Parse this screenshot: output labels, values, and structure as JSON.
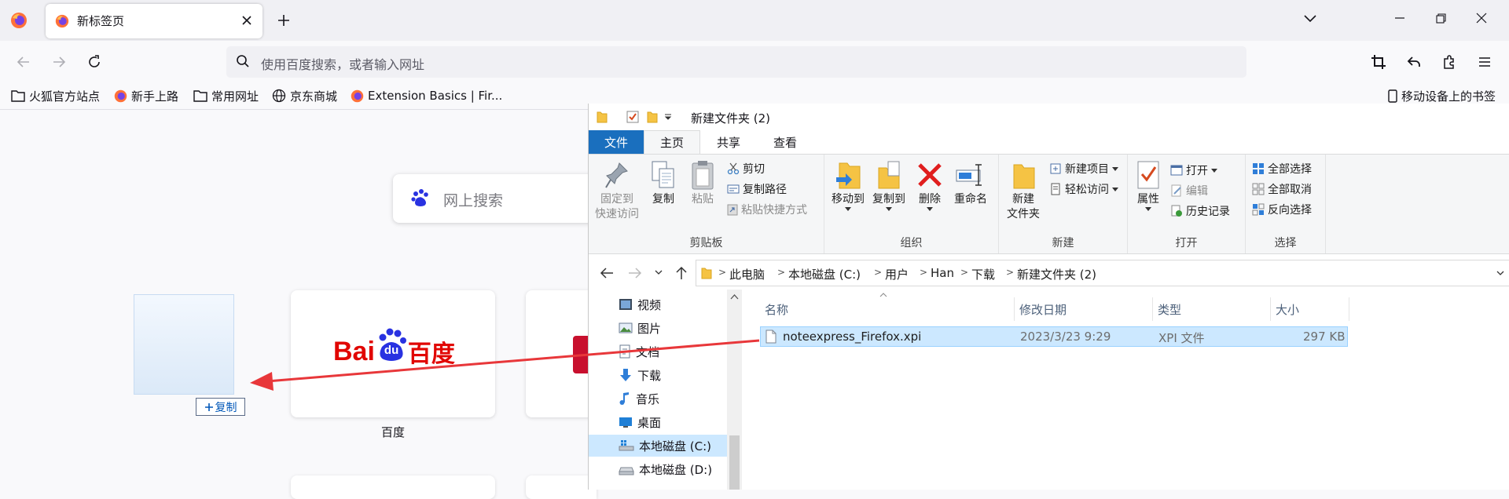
{
  "browser": {
    "tab_title": "新标签页",
    "urlbar_placeholder": "使用百度搜索，或者输入网址",
    "bookmarks": [
      "火狐官方站点",
      "新手上路",
      "常用网址",
      "京东商城",
      "Extension Basics | Fir..."
    ],
    "mobile_bookmarks": "移动设备上的书签"
  },
  "newtab": {
    "search_placeholder": "网上搜索",
    "copy_tooltip": "复制",
    "tiles": [
      {
        "label": "百度",
        "logo_text": "Bai",
        "logo_du": "du",
        "logo_cn": "百度"
      }
    ]
  },
  "explorer": {
    "title": "新建文件夹 (2)",
    "ribbon_tabs": [
      "文件",
      "主页",
      "共享",
      "查看"
    ],
    "clipboard": {
      "pin": "固定到",
      "pin2": "快速访问",
      "copy": "复制",
      "paste": "粘贴",
      "cut": "剪切",
      "copy_path": "复制路径",
      "paste_shortcut": "粘贴快捷方式",
      "label": "剪贴板"
    },
    "organize": {
      "move_to": "移动到",
      "copy_to": "复制到",
      "delete": "删除",
      "rename": "重命名",
      "label": "组织"
    },
    "new": {
      "new_folder": "新建",
      "new_folder2": "文件夹",
      "new_item": "新建项目",
      "easy_access": "轻松访问",
      "label": "新建"
    },
    "open": {
      "properties": "属性",
      "open": "打开",
      "edit": "编辑",
      "history": "历史记录",
      "label": "打开"
    },
    "select": {
      "select_all": "全部选择",
      "select_none": "全部取消",
      "invert": "反向选择",
      "label": "选择"
    },
    "breadcrumb": [
      "此电脑",
      "本地磁盘 (C:)",
      "用户",
      "Han",
      "下载",
      "新建文件夹 (2)"
    ],
    "nav": [
      "视频",
      "图片",
      "文档",
      "下载",
      "音乐",
      "桌面",
      "本地磁盘 (C:)",
      "本地磁盘 (D:)"
    ],
    "columns": [
      "名称",
      "修改日期",
      "类型",
      "大小"
    ],
    "files": [
      {
        "name": "noteexpress_Firefox.xpi",
        "date": "2023/3/23 9:29",
        "type": "XPI 文件",
        "size": "297 KB"
      }
    ]
  },
  "colors": {
    "accent": "#1a6fbe",
    "selection": "#cce8ff",
    "arrow": "#e8373a"
  }
}
